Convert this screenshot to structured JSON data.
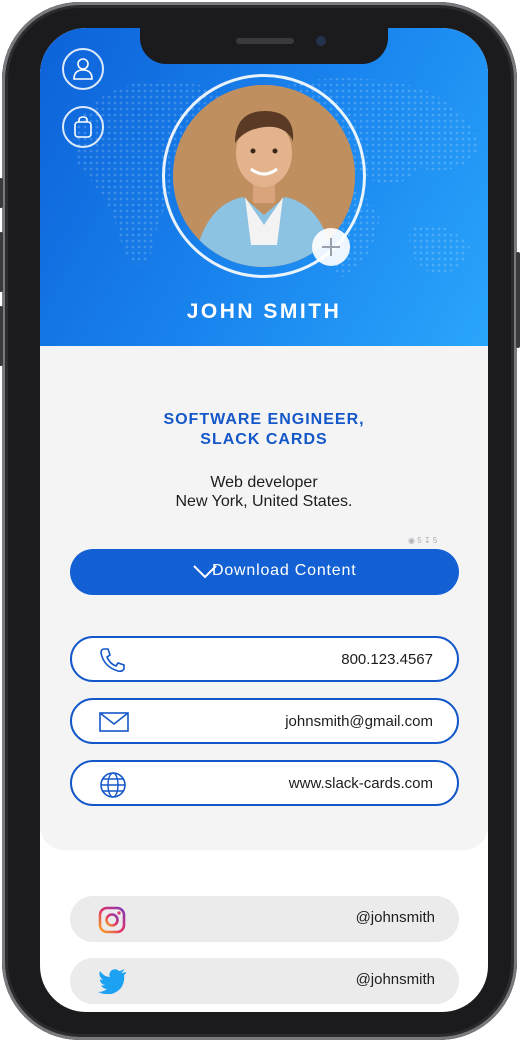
{
  "profile": {
    "name": "JOHN SMITH",
    "title_line1": "SOFTWARE ENGINEER,",
    "title_line2": "SLACK CARDS",
    "desc_line1": "Web developer",
    "desc_line2": "New York, United States."
  },
  "stats": {
    "views": "5",
    "downloads": "5"
  },
  "actions": {
    "download_label": "Download Content"
  },
  "contacts": [
    {
      "icon": "phone-icon",
      "value": "800.123.4567"
    },
    {
      "icon": "mail-icon",
      "value": "johnsmith@gmail.com"
    },
    {
      "icon": "globe-icon",
      "value": "www.slack-cards.com"
    }
  ],
  "social": [
    {
      "icon": "instagram-icon",
      "value": "@johnsmith"
    },
    {
      "icon": "twitter-icon",
      "value": "@johnsmith"
    }
  ],
  "colors": {
    "accent": "#1457c9",
    "header_gradient_start": "#0d62d8",
    "header_gradient_end": "#2aa6fb"
  }
}
